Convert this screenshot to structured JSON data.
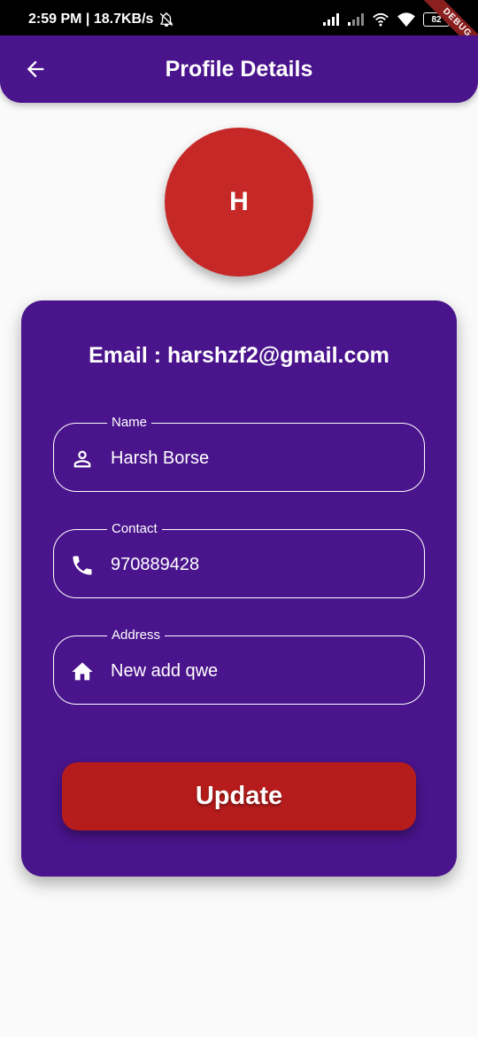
{
  "status_bar": {
    "time_speed": "2:59 PM | 18.7KB/s",
    "battery": "82",
    "debug_label": "DEBUG"
  },
  "app_bar": {
    "title": "Profile Details"
  },
  "avatar": {
    "initial": "H"
  },
  "card": {
    "email_text": "Email : harshzf2@gmail.com",
    "fields": [
      {
        "label": "Name",
        "value": "Harsh Borse",
        "icon": "person-outline-icon"
      },
      {
        "label": "Contact",
        "value": "970889428",
        "icon": "phone-icon"
      },
      {
        "label": "Address",
        "value": "New add qwe",
        "icon": "home-icon"
      }
    ],
    "update_label": "Update"
  },
  "colors": {
    "primary": "#4a148c",
    "avatar": "#c62828",
    "button": "#b71c1c",
    "background": "#fafafa"
  }
}
